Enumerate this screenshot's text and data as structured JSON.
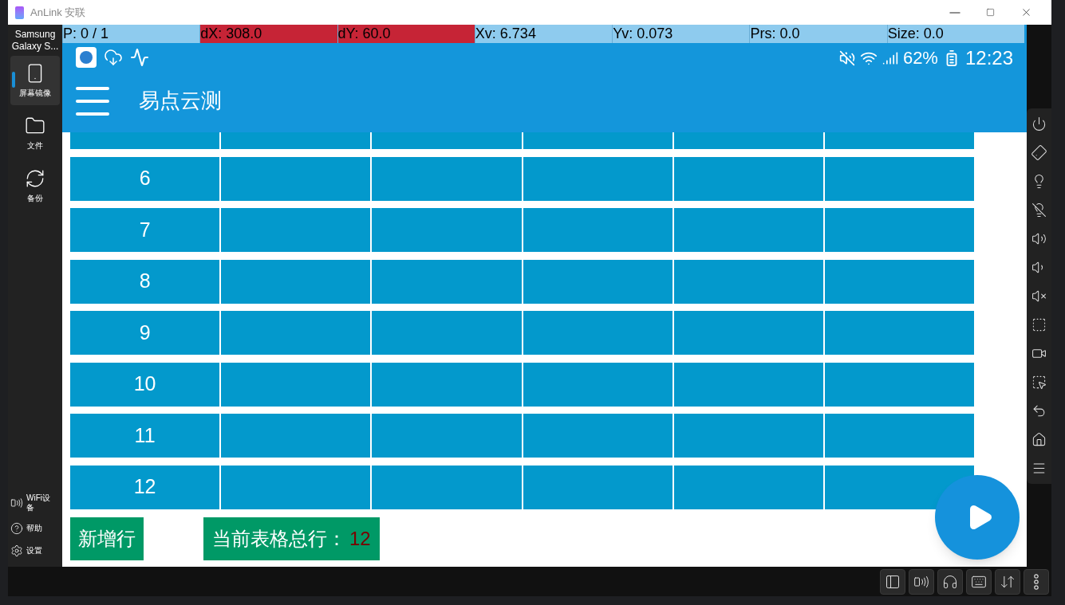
{
  "window": {
    "title": "AnLink 安联"
  },
  "sidebar": {
    "device": "Samsung Galaxy S...",
    "items": [
      {
        "label": "屏幕镜像",
        "selected": true
      },
      {
        "label": "文件",
        "selected": false
      },
      {
        "label": "备份",
        "selected": false
      }
    ],
    "bottom_items": [
      {
        "label": "WiFi设备"
      },
      {
        "label": "帮助"
      },
      {
        "label": "设置"
      }
    ]
  },
  "debug_bar": [
    {
      "text": "P: 0 / 1",
      "highlighted": false
    },
    {
      "text": "dX: 308.0",
      "highlighted": true
    },
    {
      "text": "dY: 60.0",
      "highlighted": true
    },
    {
      "text": "Xv: 6.734",
      "highlighted": false
    },
    {
      "text": "Yv: 0.073",
      "highlighted": false
    },
    {
      "text": "Prs: 0.0",
      "highlighted": false
    },
    {
      "text": "Size: 0.0",
      "highlighted": false
    }
  ],
  "status_bar": {
    "battery": "62%",
    "time": "12:23"
  },
  "app_bar": {
    "title": "易点云测"
  },
  "table": {
    "rows": [
      {
        "partial": true
      },
      {
        "label": "6"
      },
      {
        "label": "7"
      },
      {
        "label": "8"
      },
      {
        "label": "9"
      },
      {
        "label": "10"
      },
      {
        "label": "11"
      },
      {
        "label": "12"
      }
    ]
  },
  "actions": {
    "add_row": "新增行",
    "total_label": "当前表格总行：",
    "total_value": "12"
  }
}
